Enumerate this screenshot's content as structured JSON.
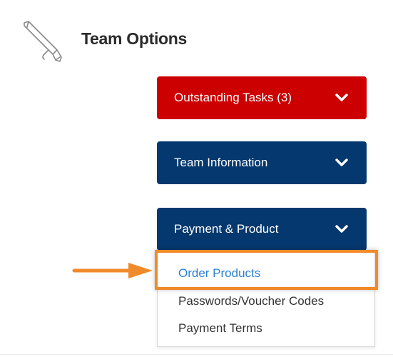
{
  "panel": {
    "title": "Team Options",
    "icon": "pen-icon"
  },
  "sections": [
    {
      "label": "Outstanding Tasks (3)",
      "color": "#cc0000",
      "icon": "chevron-down-icon"
    },
    {
      "label": "Team Information",
      "color": "#05386e",
      "icon": "chevron-down-icon"
    },
    {
      "label": "Payment & Product",
      "color": "#05386e",
      "icon": "chevron-down-icon"
    }
  ],
  "dropdown": {
    "items": [
      {
        "label": "Order Products",
        "active": true
      },
      {
        "label": "Passwords/Voucher Codes",
        "active": false
      },
      {
        "label": "Payment Terms",
        "active": false
      }
    ]
  },
  "annotation": {
    "highlight_color": "#f08a2a",
    "arrow_color": "#f08a2a"
  }
}
